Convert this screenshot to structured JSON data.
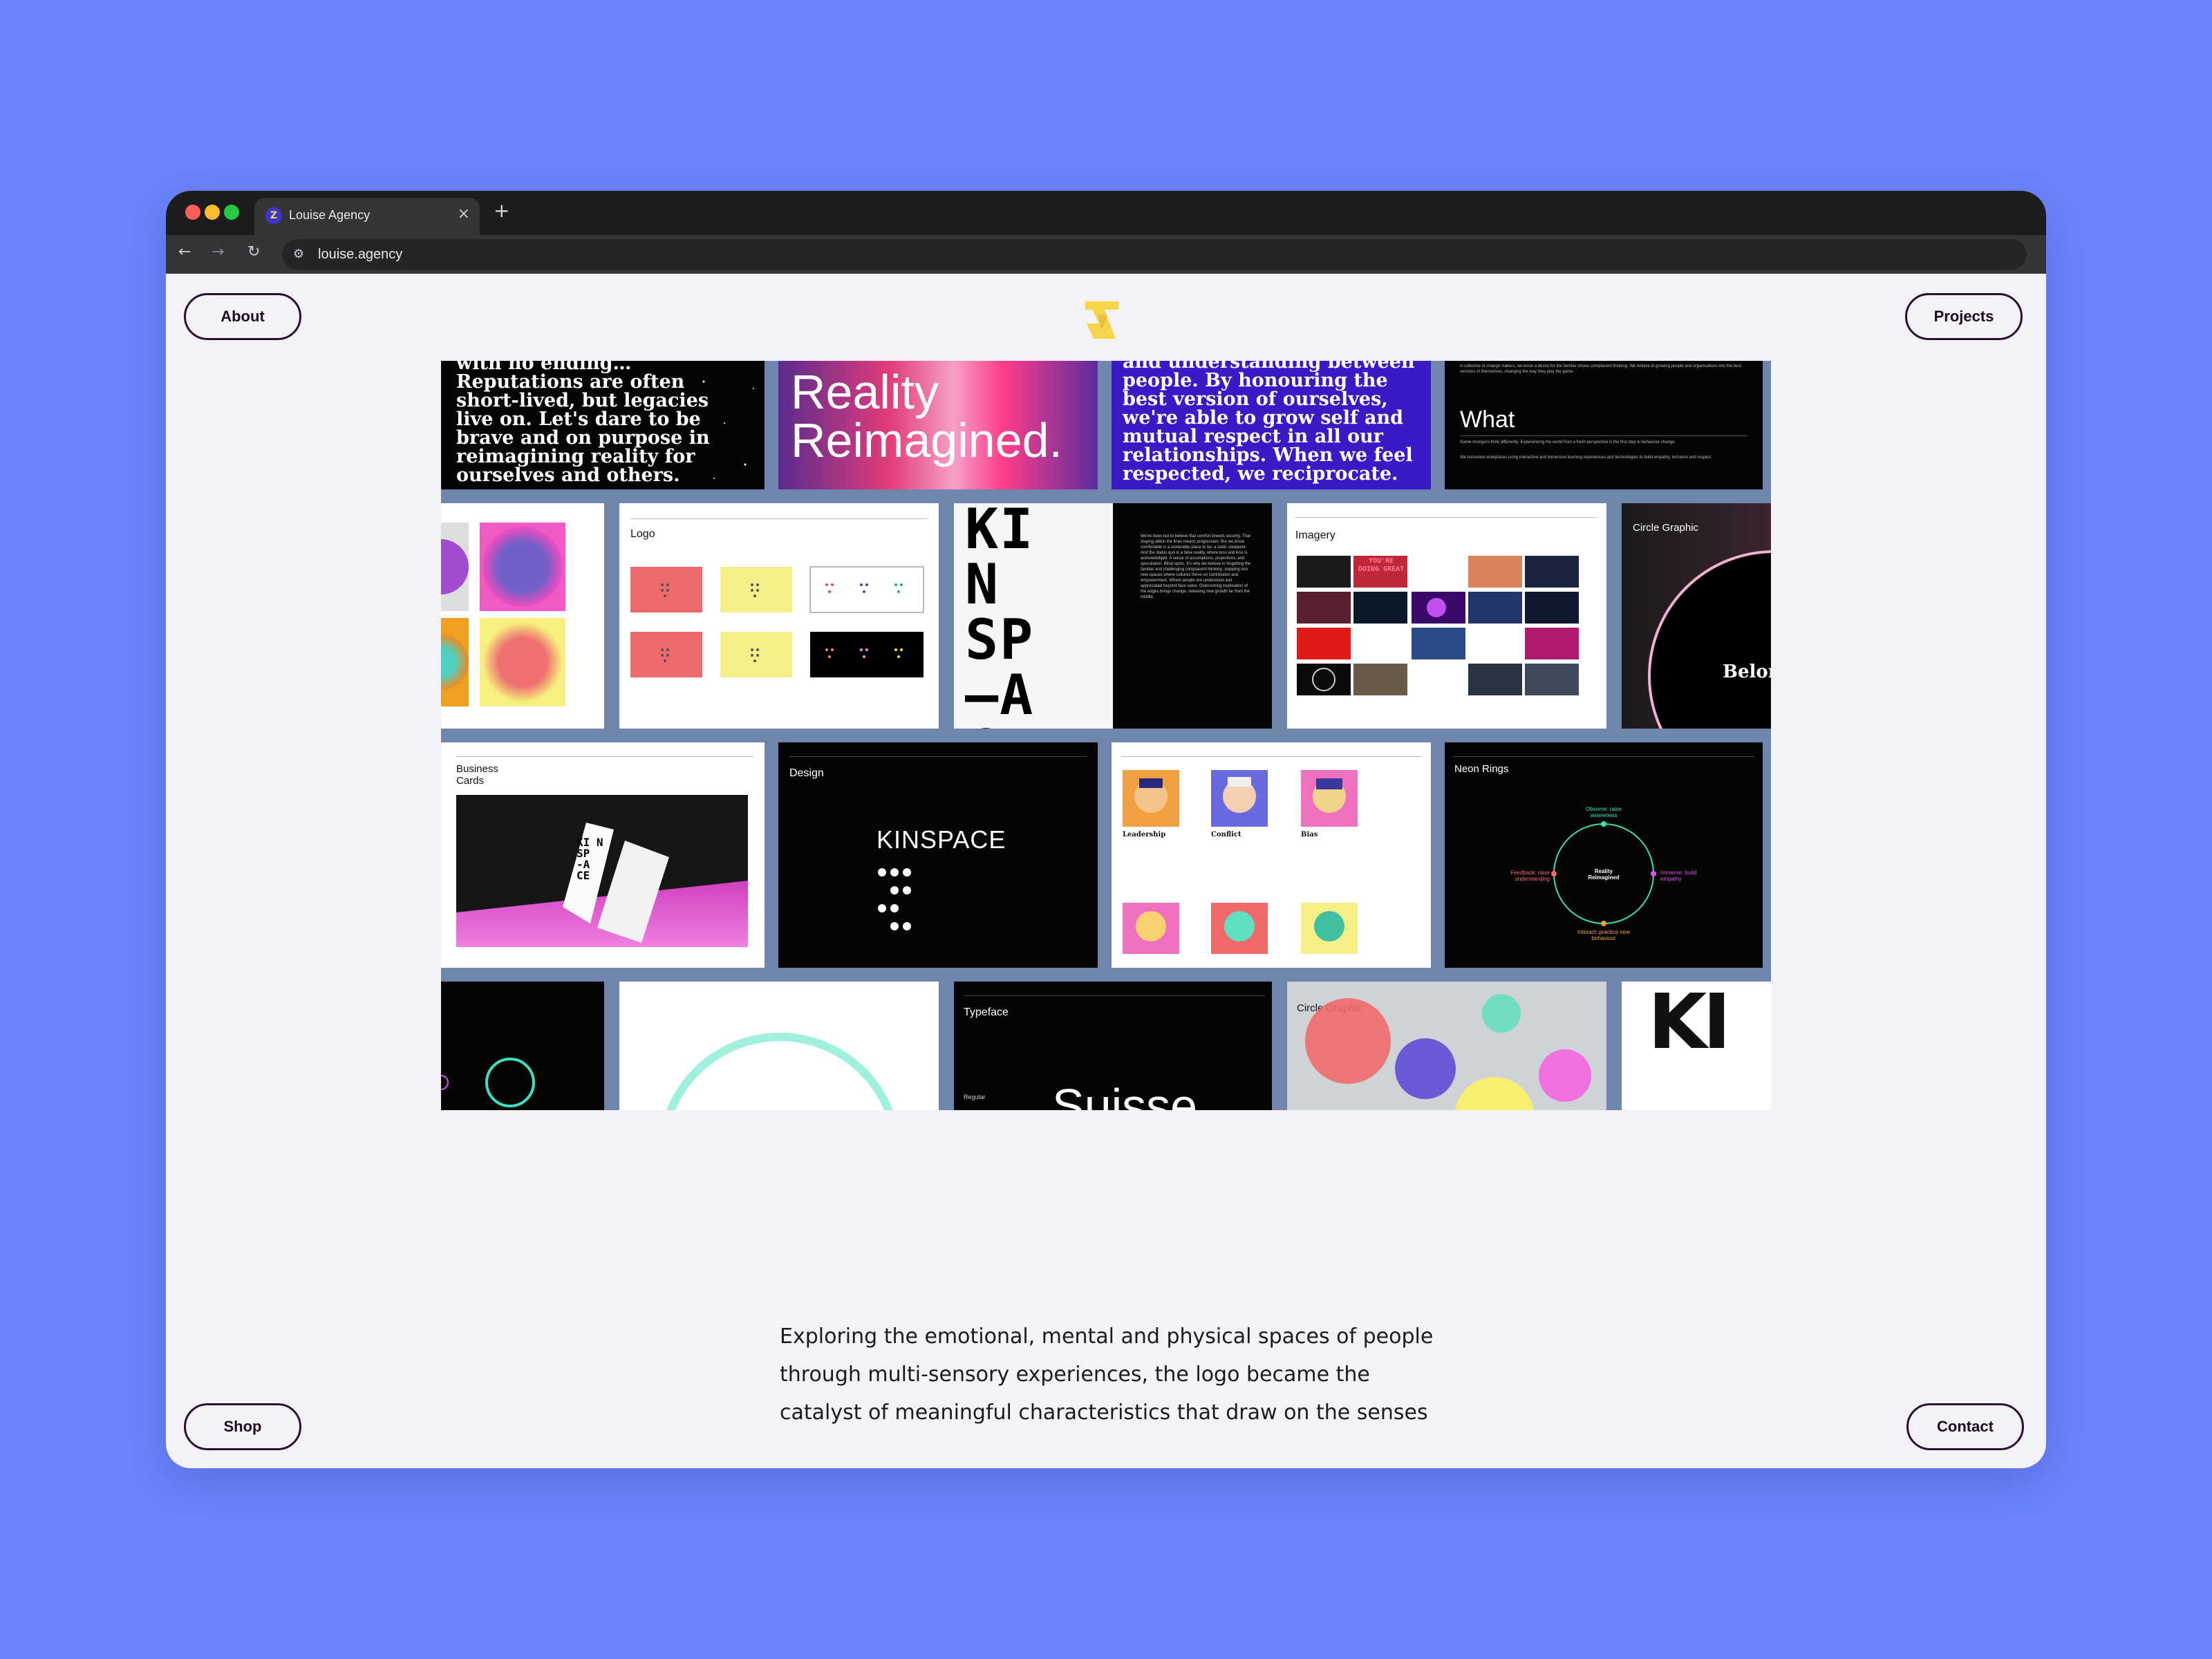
{
  "browser": {
    "tab_title": "Louise Agency",
    "tab_close": "×",
    "new_tab": "+",
    "url": "louise.agency",
    "back": "←",
    "forward": "→",
    "reload": "↻"
  },
  "nav": {
    "about": "About",
    "projects": "Projects",
    "shop": "Shop",
    "contact": "Contact"
  },
  "tiles": {
    "serif_quote_1": "with no ending…Reputations are often short-lived, but legacies live on. Let's dare to be brave and on purpose in reimagining reality for ourselves and others.",
    "reality_reimagined": "Reality Reimagined.",
    "serif_quote_2": "and understanding between people. By honouring the best version of ourselves, we're able to grow self and mutual respect in all our relationships. When we feel respected, we reciprocate.",
    "what": "What",
    "logo": "Logo",
    "kinspace_lettering": "KI N SP —A CE",
    "imagery": "Imagery",
    "youre_doing_great": "YOU'RE DOING GREAT",
    "circle_graphic": "Circle Graphic",
    "belong_text": "Belon feelin forma",
    "business_cards": "Business Cards",
    "design": "Design",
    "kinspace_wordmark": "KINSPACE",
    "leadership": "Leadership",
    "conflict": "Conflict",
    "bias": "Bias",
    "neon_rings": "Neon Rings",
    "observe": "Observe: raise awareness",
    "feedback": "Feedback: raise understanding",
    "immerse": "Immerse: build empathy",
    "interact": "Interact: practice new behaviour",
    "reality_reimagined_small": "Reality Reimagined",
    "typeface": "Typeface",
    "circle_graphic_2": "Circle Graphic",
    "swiss": "Suisse",
    "regular": "Regular"
  },
  "caption": {
    "line1": "Exploring the emotional, mental and physical spaces of people",
    "line2": "through multi-sensory experiences, the logo became the",
    "line3": "catalyst of meaningful characteristics that draw on the senses"
  },
  "colors": {
    "background": "#6b84fb",
    "page": "#f3f2f6",
    "pill_border": "#2c0e35",
    "grid_bg": "#7085ad",
    "logo_yellow": "#f6d54a"
  }
}
